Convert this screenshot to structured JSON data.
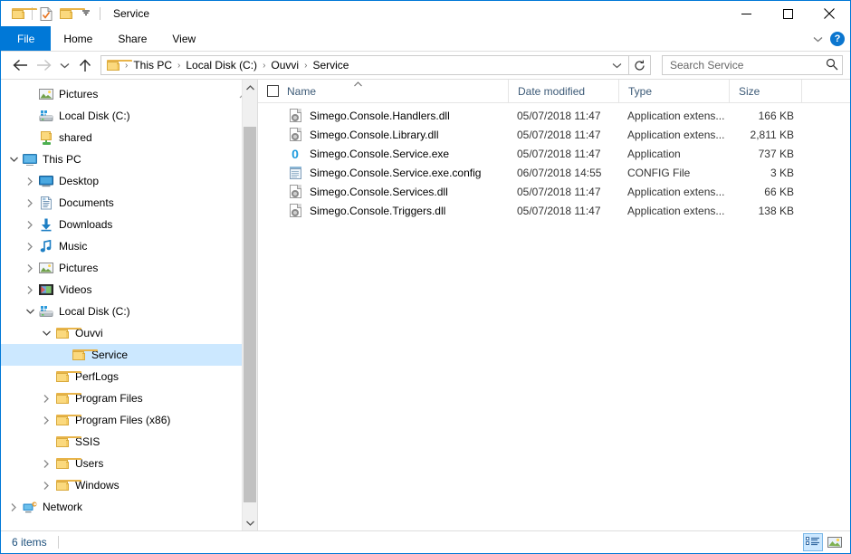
{
  "window": {
    "title": "Service",
    "quick_access": [
      {
        "name": "folder-icon",
        "label": "Folder"
      },
      {
        "name": "properties-icon",
        "label": "Properties"
      },
      {
        "name": "new-folder-icon",
        "label": "New folder"
      },
      {
        "name": "chevron-down-icon",
        "label": "Customize Quick Access Toolbar"
      }
    ],
    "controls": {
      "minimize": "Minimize",
      "maximize": "Maximize",
      "close": "Close"
    }
  },
  "ribbon": {
    "tabs": [
      {
        "label": "File",
        "active": true
      },
      {
        "label": "Home",
        "active": false
      },
      {
        "label": "Share",
        "active": false
      },
      {
        "label": "View",
        "active": false
      }
    ],
    "expand_label": "Expand the Ribbon",
    "help_label": "?"
  },
  "address": {
    "back": "Back",
    "forward": "Forward",
    "recent": "Recent locations",
    "up": "Up",
    "breadcrumbs": [
      "This PC",
      "Local Disk (C:)",
      "Ouvvi",
      "Service"
    ],
    "separator": "›",
    "dropdown": "Previous locations",
    "refresh": "Refresh"
  },
  "search": {
    "placeholder": "Search Service",
    "value": ""
  },
  "sidebar": {
    "items": [
      {
        "label": "Pictures",
        "icon": "pictures-icon",
        "indent": 1,
        "chevron": "none",
        "pinned": true,
        "selected": false
      },
      {
        "label": "Local Disk (C:)",
        "icon": "drive-icon",
        "indent": 1,
        "chevron": "none",
        "pinned": false,
        "selected": false
      },
      {
        "label": "shared",
        "icon": "shared-folder-icon",
        "indent": 1,
        "chevron": "none",
        "pinned": false,
        "selected": false
      },
      {
        "label": "This PC",
        "icon": "computer-icon",
        "indent": 0,
        "chevron": "down",
        "pinned": false,
        "selected": false
      },
      {
        "label": "Desktop",
        "icon": "desktop-icon",
        "indent": 1,
        "chevron": "right",
        "pinned": false,
        "selected": false
      },
      {
        "label": "Documents",
        "icon": "documents-icon",
        "indent": 1,
        "chevron": "right",
        "pinned": false,
        "selected": false
      },
      {
        "label": "Downloads",
        "icon": "downloads-icon",
        "indent": 1,
        "chevron": "right",
        "pinned": false,
        "selected": false
      },
      {
        "label": "Music",
        "icon": "music-icon",
        "indent": 1,
        "chevron": "right",
        "pinned": false,
        "selected": false
      },
      {
        "label": "Pictures",
        "icon": "pictures-icon",
        "indent": 1,
        "chevron": "right",
        "pinned": false,
        "selected": false
      },
      {
        "label": "Videos",
        "icon": "videos-icon",
        "indent": 1,
        "chevron": "right",
        "pinned": false,
        "selected": false
      },
      {
        "label": "Local Disk (C:)",
        "icon": "drive-icon",
        "indent": 1,
        "chevron": "down",
        "pinned": false,
        "selected": false
      },
      {
        "label": "Ouvvi",
        "icon": "folder-icon",
        "indent": 2,
        "chevron": "down",
        "pinned": false,
        "selected": false
      },
      {
        "label": "Service",
        "icon": "folder-icon",
        "indent": 3,
        "chevron": "none",
        "pinned": false,
        "selected": true
      },
      {
        "label": "PerfLogs",
        "icon": "folder-icon",
        "indent": 2,
        "chevron": "none",
        "pinned": false,
        "selected": false
      },
      {
        "label": "Program Files",
        "icon": "folder-icon",
        "indent": 2,
        "chevron": "right",
        "pinned": false,
        "selected": false
      },
      {
        "label": "Program Files (x86)",
        "icon": "folder-icon",
        "indent": 2,
        "chevron": "right",
        "pinned": false,
        "selected": false
      },
      {
        "label": "SSIS",
        "icon": "folder-icon",
        "indent": 2,
        "chevron": "none",
        "pinned": false,
        "selected": false
      },
      {
        "label": "Users",
        "icon": "folder-icon",
        "indent": 2,
        "chevron": "right",
        "pinned": false,
        "selected": false
      },
      {
        "label": "Windows",
        "icon": "folder-icon",
        "indent": 2,
        "chevron": "right",
        "pinned": false,
        "selected": false
      },
      {
        "label": "Network",
        "icon": "network-icon",
        "indent": 0,
        "chevron": "right",
        "pinned": false,
        "selected": false
      }
    ]
  },
  "filelist": {
    "columns": [
      {
        "key": "name",
        "label": "Name",
        "sort": "asc"
      },
      {
        "key": "date",
        "label": "Date modified",
        "sort": "none"
      },
      {
        "key": "type",
        "label": "Type",
        "sort": "none"
      },
      {
        "key": "size",
        "label": "Size",
        "sort": "none"
      }
    ],
    "rows": [
      {
        "name": "Simego.Console.Handlers.dll",
        "date": "05/07/2018 11:47",
        "type": "Application extens...",
        "size": "166 KB",
        "icon": "dll-file-icon"
      },
      {
        "name": "Simego.Console.Library.dll",
        "date": "05/07/2018 11:47",
        "type": "Application extens...",
        "size": "2,811 KB",
        "icon": "dll-file-icon"
      },
      {
        "name": "Simego.Console.Service.exe",
        "date": "05/07/2018 11:47",
        "type": "Application",
        "size": "737 KB",
        "icon": "exe-file-icon"
      },
      {
        "name": "Simego.Console.Service.exe.config",
        "date": "06/07/2018 14:55",
        "type": "CONFIG File",
        "size": "3 KB",
        "icon": "config-file-icon"
      },
      {
        "name": "Simego.Console.Services.dll",
        "date": "05/07/2018 11:47",
        "type": "Application extens...",
        "size": "66 KB",
        "icon": "dll-file-icon"
      },
      {
        "name": "Simego.Console.Triggers.dll",
        "date": "05/07/2018 11:47",
        "type": "Application extens...",
        "size": "138 KB",
        "icon": "dll-file-icon"
      }
    ]
  },
  "statusbar": {
    "item_count": "6 items",
    "views": [
      {
        "name": "details-view-button",
        "label": "Details view",
        "active": true
      },
      {
        "name": "large-icons-view-button",
        "label": "Large icons view",
        "active": false
      }
    ]
  },
  "colors": {
    "accent": "#0078d7",
    "selection": "#cce8ff",
    "header_text": "#3c5a77",
    "status_text": "#1c4f7c",
    "folder_yellow": "#fbd97e",
    "exe_blue": "#1e9bde"
  }
}
